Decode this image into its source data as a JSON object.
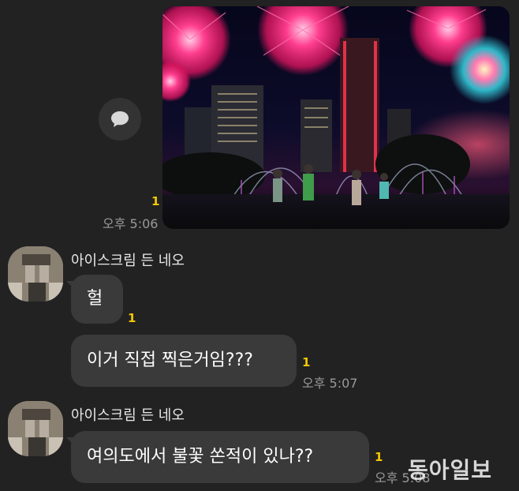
{
  "messages": {
    "sent_photo": {
      "unread": "1",
      "time": "오후 5:06",
      "image_icon": "fireworks-cityscape-photo"
    },
    "share_icon": "speech-bubble-icon",
    "group1": {
      "sender": "아이스크림 든 네오",
      "bubble1": {
        "text": "헐",
        "unread": "1"
      },
      "bubble2": {
        "text": "이거 직접 찍은거임???",
        "unread": "1",
        "time": "오후 5:07"
      }
    },
    "group2": {
      "sender": "아이스크림 든 네오",
      "bubble1": {
        "text": "여의도에서 불꽃 쏜적이 있나??",
        "unread": "1",
        "time": "오후 5:08"
      }
    }
  },
  "watermark": "동아일보",
  "colors": {
    "background": "#222222",
    "bubble": "#3a3a3a",
    "unread": "#f3c800",
    "time": "#9a9a9a"
  }
}
